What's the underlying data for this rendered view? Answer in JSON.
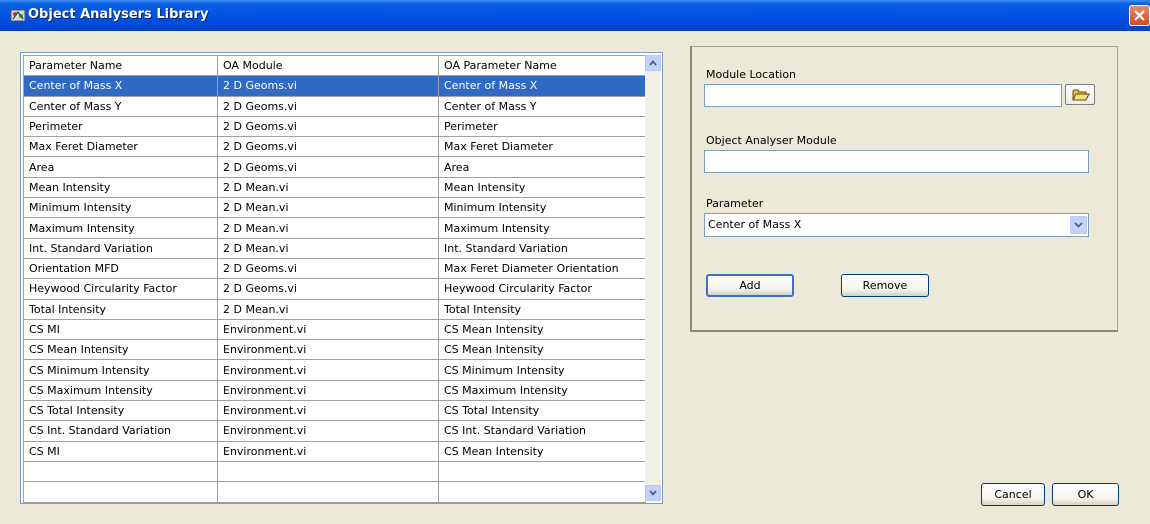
{
  "window": {
    "title": "Object Analysers Library",
    "close_label": "X"
  },
  "grid": {
    "columns": [
      "Parameter Name",
      "OA Module",
      "OA Parameter Name"
    ],
    "selected_row": 0,
    "rows": [
      [
        "Center of Mass X",
        "2 D Geoms.vi",
        "Center of Mass X"
      ],
      [
        "Center of Mass Y",
        "2 D Geoms.vi",
        "Center of Mass Y"
      ],
      [
        "Perimeter",
        "2 D Geoms.vi",
        "Perimeter"
      ],
      [
        "Max Feret Diameter",
        "2 D Geoms.vi",
        "Max Feret Diameter"
      ],
      [
        "Area",
        "2 D Geoms.vi",
        "Area"
      ],
      [
        "Mean Intensity",
        "2 D Mean.vi",
        "Mean Intensity"
      ],
      [
        "Minimum Intensity",
        "2 D Mean.vi",
        "Minimum Intensity"
      ],
      [
        "Maximum Intensity",
        "2 D Mean.vi",
        "Maximum Intensity"
      ],
      [
        "Int. Standard Variation",
        "2 D Mean.vi",
        "Int. Standard Variation"
      ],
      [
        "Orientation MFD",
        "2 D Geoms.vi",
        "Max Feret Diameter Orientation"
      ],
      [
        "Heywood Circularity Factor",
        "2 D Geoms.vi",
        "Heywood Circularity Factor"
      ],
      [
        "Total Intensity",
        "2 D Mean.vi",
        "Total Intensity"
      ],
      [
        "CS MI",
        "Environment.vi",
        "CS Mean Intensity"
      ],
      [
        "CS Mean Intensity",
        "Environment.vi",
        "CS Mean Intensity"
      ],
      [
        "CS Minimum Intensity",
        "Environment.vi",
        "CS Minimum Intensity"
      ],
      [
        "CS Maximum Intensity",
        "Environment.vi",
        "CS Maximum Intensity"
      ],
      [
        "CS Total Intensity",
        "Environment.vi",
        "CS Total Intensity"
      ],
      [
        "CS Int. Standard Variation",
        "Environment.vi",
        "CS Int. Standard Variation"
      ],
      [
        "CS MI",
        "Environment.vi",
        "CS Mean Intensity"
      ],
      [
        "",
        "",
        ""
      ],
      [
        "",
        "",
        ""
      ]
    ]
  },
  "form": {
    "module_location_label": "Module Location",
    "module_location_value": "",
    "analyser_module_label": "Object Analyser Module",
    "analyser_module_value": "",
    "parameter_label": "Parameter",
    "parameter_value": "Center of Mass X"
  },
  "buttons": {
    "add": "Add",
    "remove": "Remove",
    "cancel": "Cancel",
    "ok": "OK"
  },
  "icons": {
    "title_icon": "app-icon",
    "folder": "folder-open-icon",
    "scroll_up": "chevron-up-icon",
    "scroll_down": "chevron-down-icon",
    "dropdown": "chevron-down-icon",
    "close": "close-icon"
  }
}
